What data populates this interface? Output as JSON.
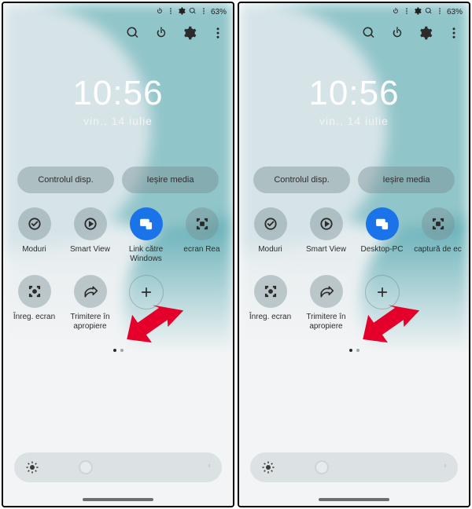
{
  "status": {
    "battery_pct": "63%"
  },
  "clock": {
    "time": "10:56",
    "date": "vin., 14 iulie"
  },
  "panels": [
    {
      "chips": [
        "Controlul disp.",
        "Ieșire media"
      ],
      "rows": [
        [
          {
            "label": "Moduri",
            "icon": "moduri",
            "on": false
          },
          {
            "label": "Smart View",
            "icon": "smartview",
            "on": false
          },
          {
            "label": "Link către Windows",
            "icon": "link",
            "on": true
          },
          {
            "label": "ecran    Rea",
            "icon": "capture",
            "on": false,
            "extra": true
          }
        ],
        [
          {
            "label": "Înreg. ecran",
            "icon": "record",
            "on": false
          },
          {
            "label": "Trimitere în apropiere",
            "icon": "share",
            "on": false
          },
          {
            "label": "",
            "icon": "add",
            "on": false,
            "add": true
          }
        ]
      ]
    },
    {
      "chips": [
        "Controlul disp.",
        "Ieșire media"
      ],
      "rows": [
        [
          {
            "label": "Moduri",
            "icon": "moduri",
            "on": false
          },
          {
            "label": "Smart View",
            "icon": "smartview",
            "on": false
          },
          {
            "label": "Desktop-PC",
            "icon": "link",
            "on": true
          },
          {
            "label": "captură de ec",
            "icon": "capture",
            "on": false,
            "extra": true
          }
        ],
        [
          {
            "label": "Înreg. ecran",
            "icon": "record",
            "on": false
          },
          {
            "label": "Trimitere în apropiere",
            "icon": "share",
            "on": false
          },
          {
            "label": "",
            "icon": "add",
            "on": false,
            "add": true
          }
        ]
      ]
    }
  ]
}
